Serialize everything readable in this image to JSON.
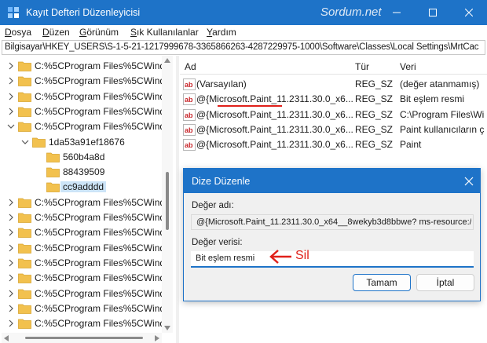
{
  "window": {
    "title": "Kayıt Defteri Düzenleyicisi",
    "watermark": "Sordum.net"
  },
  "menu": {
    "items": [
      {
        "label": "Dosya",
        "accel": "D",
        "rest": "osya"
      },
      {
        "label": "Düzen",
        "accel": "D",
        "rest": "üzen"
      },
      {
        "label": "Görünüm",
        "accel": "G",
        "rest": "örünüm"
      },
      {
        "label": "Sık Kullanılanlar",
        "accel": "S",
        "rest": "ık Kullanılanlar"
      },
      {
        "label": "Yardım",
        "accel": "Y",
        "rest": "ardım"
      }
    ]
  },
  "address": {
    "path": "Bilgisayar\\HKEY_USERS\\S-1-5-21-1217999678-3365866263-4287229975-1000\\Software\\Classes\\Local Settings\\MrtCac"
  },
  "tree": {
    "items": [
      {
        "label": "C:%5CProgram Files%5CWindo",
        "expanded": false
      },
      {
        "label": "C:%5CProgram Files%5CWindo",
        "expanded": false
      },
      {
        "label": "C:%5CProgram Files%5CWindo",
        "expanded": false
      },
      {
        "label": "C:%5CProgram Files%5CWindo",
        "expanded": false
      },
      {
        "label": "C:%5CProgram Files%5CWindo",
        "expanded": true
      },
      {
        "label": "1da53a91ef18676",
        "expanded": true
      },
      {
        "label": "560b4a8d",
        "expanded": null
      },
      {
        "label": "88439509",
        "expanded": null
      },
      {
        "label": "cc9adddd",
        "expanded": null,
        "selected": true
      },
      {
        "label": "C:%5CProgram Files%5CWindo",
        "expanded": false
      },
      {
        "label": "C:%5CProgram Files%5CWindo",
        "expanded": false
      },
      {
        "label": "C:%5CProgram Files%5CWindo",
        "expanded": false
      },
      {
        "label": "C:%5CProgram Files%5CWindo",
        "expanded": false
      },
      {
        "label": "C:%5CProgram Files%5CWindo",
        "expanded": false
      },
      {
        "label": "C:%5CProgram Files%5CWindo",
        "expanded": false
      },
      {
        "label": "C:%5CProgram Files%5CWindo",
        "expanded": false
      },
      {
        "label": "C:%5CProgram Files%5CWindo",
        "expanded": false
      },
      {
        "label": "C:%5CProgram Files%5CWindo",
        "expanded": false
      }
    ]
  },
  "list": {
    "columns": [
      "Ad",
      "Tür",
      "Veri"
    ],
    "rows": [
      {
        "name": "(Varsayılan)",
        "type": "REG_SZ",
        "data": "(değer atanmamış)"
      },
      {
        "name": "@{Microsoft.Paint_11.2311.30.0_x6...",
        "type": "REG_SZ",
        "data": "Bit eşlem resmi"
      },
      {
        "name": "@{Microsoft.Paint_11.2311.30.0_x6...",
        "type": "REG_SZ",
        "data": "C:\\Program Files\\Wi"
      },
      {
        "name": "@{Microsoft.Paint_11.2311.30.0_x6...",
        "type": "REG_SZ",
        "data": "Paint kullanıcıların ç"
      },
      {
        "name": "@{Microsoft.Paint_11.2311.30.0_x6...",
        "type": "REG_SZ",
        "data": "Paint"
      }
    ]
  },
  "dialog": {
    "title": "Dize Düzenle",
    "name_label": "Değer adı:",
    "name_value": "@{Microsoft.Paint_11.2311.30.0_x64__8wekyb3d8bbwe? ms-resource://M",
    "data_label": "Değer verisi:",
    "data_value": "Bit eşlem resmi",
    "annotation": "Sil",
    "ok_label": "Tamam",
    "cancel_label": "İptal"
  },
  "colors": {
    "accent": "#1e73c8",
    "annotation": "#e0201a",
    "folder": "#f2c14e"
  }
}
